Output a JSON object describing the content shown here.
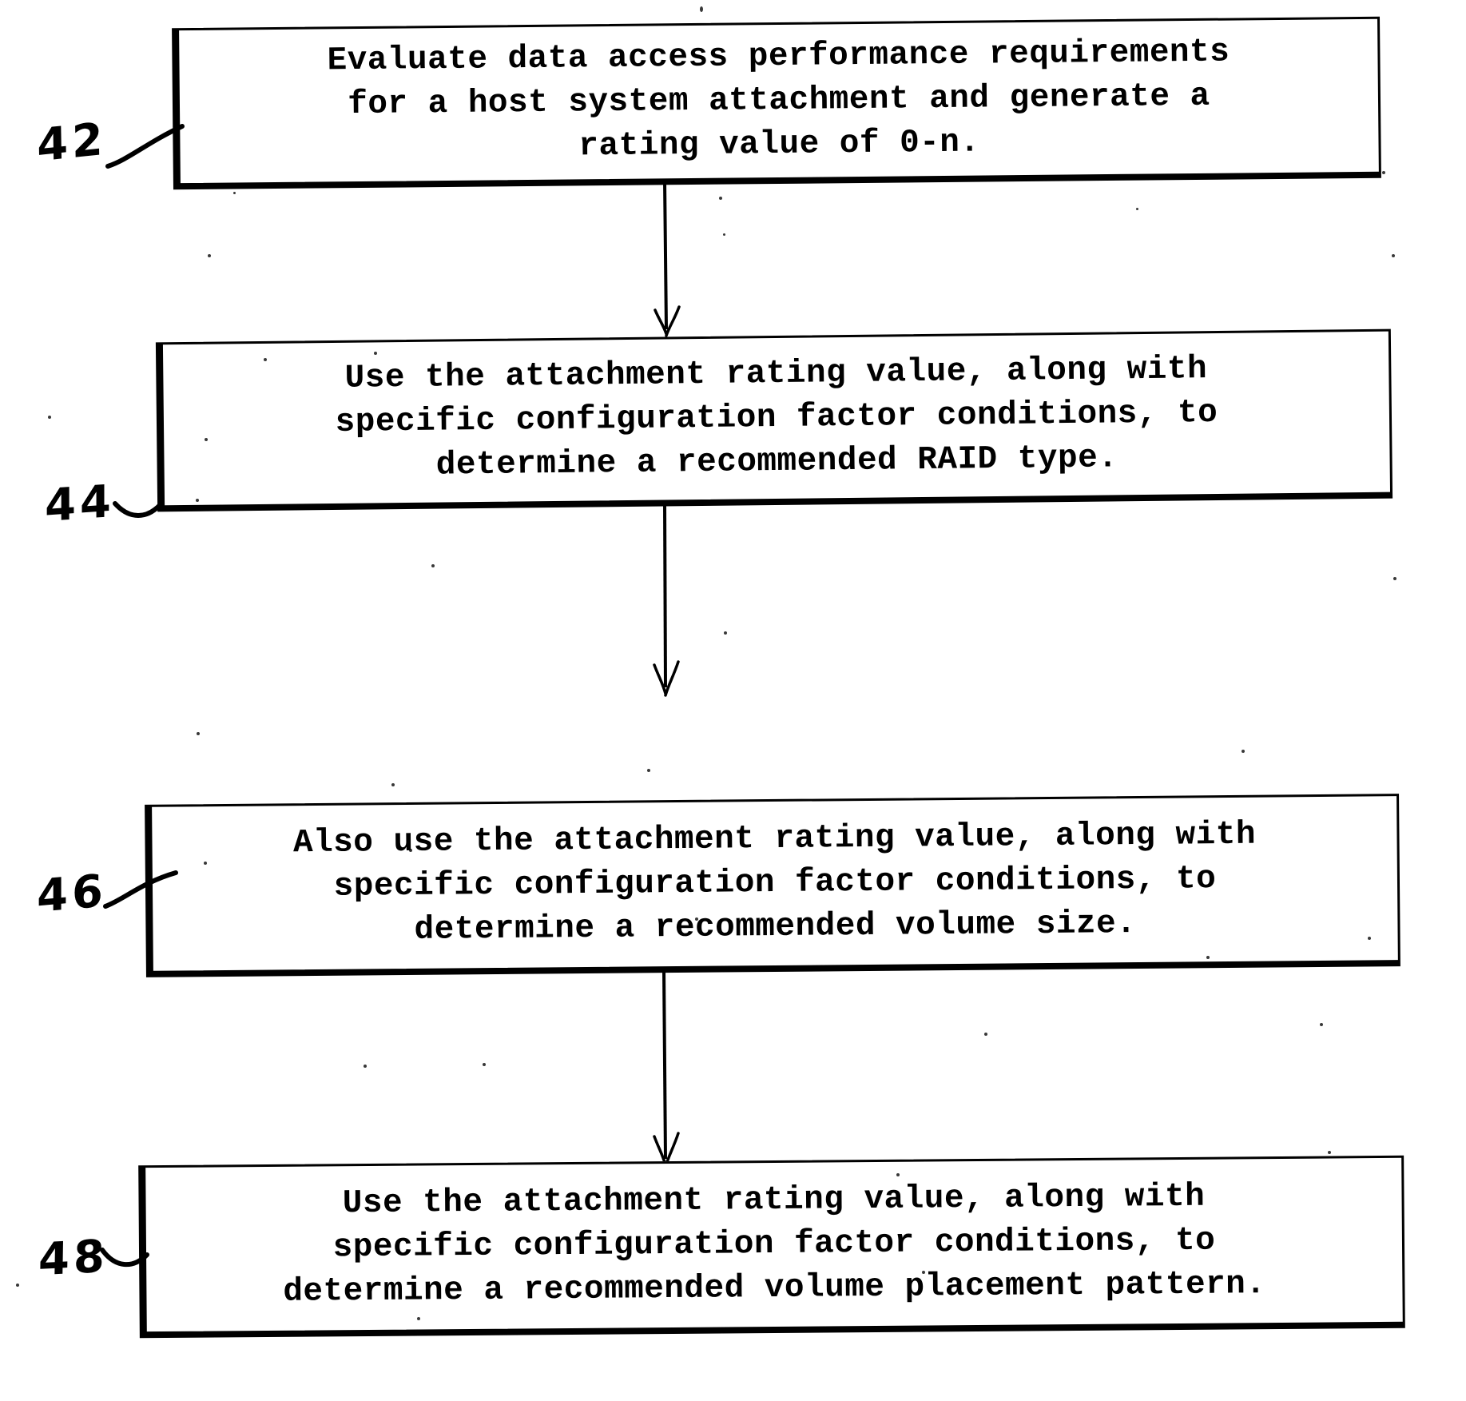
{
  "figure": {
    "kind": "patent-flowchart",
    "background_color": "#ffffff",
    "ink_color": "#000000"
  },
  "steps": [
    {
      "ref": "42",
      "name": "evaluate-performance-requirements",
      "text": "Evaluate data access performance requirements\nfor a host system attachment and generate a\nrating value of 0-n."
    },
    {
      "ref": "44",
      "name": "determine-raid-type",
      "text": "Use the attachment rating value, along with\nspecific configuration factor conditions, to\ndetermine a recommended RAID type."
    },
    {
      "ref": "46",
      "name": "determine-volume-size",
      "text": "Also use the attachment rating value, along with\nspecific configuration factor conditions, to\ndetermine a recommended volume size."
    },
    {
      "ref": "48",
      "name": "determine-volume-placement-pattern",
      "text": "Use the attachment rating value, along with\nspecific configuration factor conditions, to\ndetermine a recommended volume placement pattern."
    }
  ],
  "connectors": [
    {
      "name": "connector-42-to-44",
      "from": "42",
      "to": "44",
      "arrowhead": "open-v"
    },
    {
      "name": "connector-44-to-46",
      "from": "44",
      "to": "46",
      "arrowhead": "open-v"
    },
    {
      "name": "connector-46-to-48",
      "from": "46",
      "to": "48",
      "arrowhead": "open-v"
    }
  ]
}
